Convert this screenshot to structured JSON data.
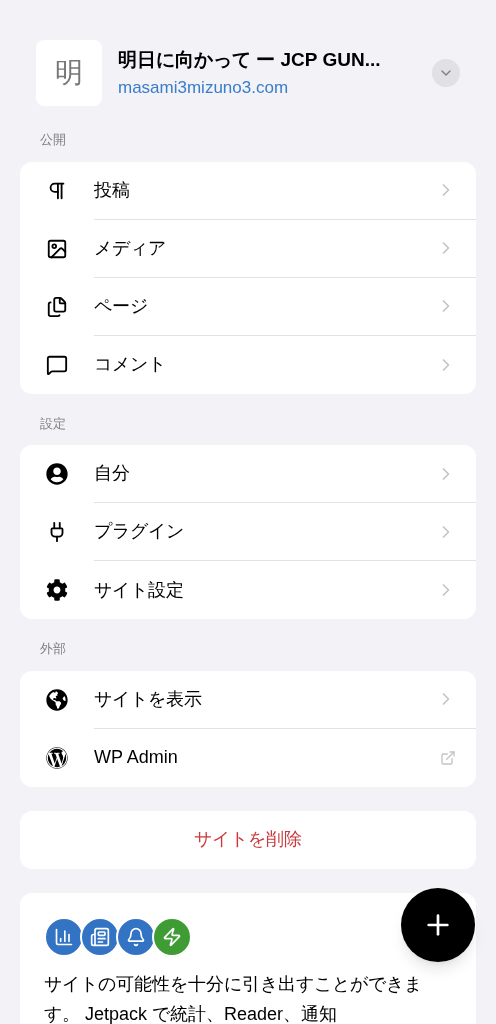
{
  "site": {
    "avatar_letter": "明",
    "title": "明日に向かって ー JCP GUN...",
    "url": "masami3mizuno3.com"
  },
  "sections": [
    {
      "label": "公開",
      "items": [
        {
          "label": "投稿",
          "kind": "link"
        },
        {
          "label": "メディア",
          "kind": "link"
        },
        {
          "label": "ページ",
          "kind": "link"
        },
        {
          "label": "コメント",
          "kind": "link"
        }
      ]
    },
    {
      "label": "設定",
      "items": [
        {
          "label": "自分",
          "kind": "link"
        },
        {
          "label": "プラグイン",
          "kind": "link"
        },
        {
          "label": "サイト設定",
          "kind": "link"
        }
      ]
    },
    {
      "label": "外部",
      "items": [
        {
          "label": "サイトを表示",
          "kind": "link"
        },
        {
          "label": "WP Admin",
          "kind": "external"
        }
      ]
    }
  ],
  "delete_button": "サイトを削除",
  "jetpack": {
    "text": "サイトの可能性を十分に引き出すことができます。 Jetpack で統計、Reader、通知"
  }
}
